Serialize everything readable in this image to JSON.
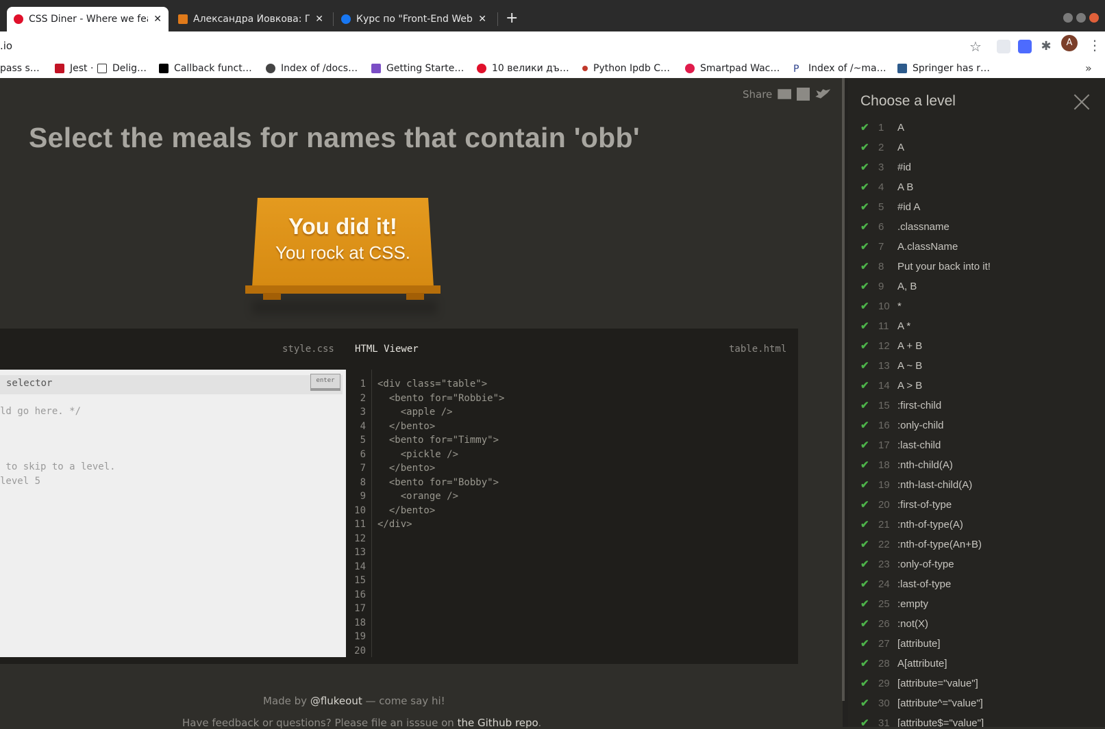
{
  "browser": {
    "tabs": [
      {
        "title": "CSS Diner - Where we feas",
        "favicon_color": "#e0102b",
        "active": true
      },
      {
        "title": "Александра Йовкова: Пу",
        "favicon_color": "#e07a1a",
        "active": false
      },
      {
        "title": "Курс по \"Front-End Web\"",
        "favicon_color": "#1877f2",
        "active": false
      }
    ],
    "new_tab_glyph": "+",
    "close_glyph": "✕",
    "address": ".io",
    "bookmarks_more": "»",
    "bookmarks": [
      {
        "label": "pass s…",
        "icon_color": "#ffffff"
      },
      {
        "label": "Jest ·",
        "icon_color": "#c21325"
      },
      {
        "label": "Delig…",
        "icon_color": "#333333"
      },
      {
        "label": "Callback funct…",
        "icon_color": "#000000"
      },
      {
        "label": "Index of /docs…",
        "icon_color": "#444444"
      },
      {
        "label": "Getting Starte…",
        "icon_color": "#7b4ec5"
      },
      {
        "label": "10 велики дъ…",
        "icon_color": "#e0102b"
      },
      {
        "label": "Python Ipdb C…",
        "icon_color": "#c0392b"
      },
      {
        "label": "Smartpad Wac…",
        "icon_color": "#e01b4b"
      },
      {
        "label": "Index of /~ma…",
        "icon_color": "#2a3f8a"
      },
      {
        "label": "Springer has r…",
        "icon_color": "#2d5b8c"
      }
    ],
    "avatar_letter": "A"
  },
  "game": {
    "share_label": "Share",
    "instruction": "Select the meals for names that contain 'obb'",
    "win_line_1": "You did it!",
    "win_line_2": "You rock at CSS.",
    "editor": {
      "css_file": "style.css",
      "html_title": "HTML Viewer",
      "html_file": "table.html",
      "selector_placeholder": "selector",
      "enter_label": "enter",
      "css_lines": [
        "ld go here. */",
        "",
        "",
        " to skip to a level.",
        "level 5"
      ],
      "html_code": [
        "<div class=\"table\">",
        "  <bento for=\"Robbie\">",
        "    <apple />",
        "  </bento>",
        "  <bento for=\"Timmy\">",
        "    <pickle />",
        "  </bento>",
        "  <bento for=\"Bobby\">",
        "    <orange />",
        "  </bento>",
        "</div>",
        "",
        "",
        "",
        "",
        "",
        "",
        "",
        "",
        ""
      ],
      "line_numbers": [
        "1",
        "2",
        "3",
        "4",
        "5",
        "6",
        "7",
        "8",
        "9",
        "10",
        "11",
        "12",
        "13",
        "14",
        "15",
        "16",
        "17",
        "18",
        "19",
        "20"
      ]
    },
    "footer": {
      "made_by_prefix": "Made by ",
      "made_by_link": "@flukeout",
      "made_by_suffix": " — come say hi!",
      "feedback_prefix": "Have feedback or questions? Please file an isssue on ",
      "feedback_link": "the Github repo",
      "feedback_suffix": "."
    }
  },
  "sidebar": {
    "title": "Choose a level",
    "check_glyph": "✔",
    "levels": [
      {
        "num": "1",
        "name": "A"
      },
      {
        "num": "2",
        "name": "A"
      },
      {
        "num": "3",
        "name": "#id"
      },
      {
        "num": "4",
        "name": "A  B"
      },
      {
        "num": "5",
        "name": "#id  A"
      },
      {
        "num": "6",
        "name": ".classname"
      },
      {
        "num": "7",
        "name": "A.className"
      },
      {
        "num": "8",
        "name": "Put your back into it!"
      },
      {
        "num": "9",
        "name": "A, B"
      },
      {
        "num": "10",
        "name": "*"
      },
      {
        "num": "11",
        "name": "A  *"
      },
      {
        "num": "12",
        "name": "A + B"
      },
      {
        "num": "13",
        "name": "A ~ B"
      },
      {
        "num": "14",
        "name": "A > B"
      },
      {
        "num": "15",
        "name": ":first-child"
      },
      {
        "num": "16",
        "name": ":only-child"
      },
      {
        "num": "17",
        "name": ":last-child"
      },
      {
        "num": "18",
        "name": ":nth-child(A)"
      },
      {
        "num": "19",
        "name": ":nth-last-child(A)"
      },
      {
        "num": "20",
        "name": ":first-of-type"
      },
      {
        "num": "21",
        "name": ":nth-of-type(A)"
      },
      {
        "num": "22",
        "name": ":nth-of-type(An+B)"
      },
      {
        "num": "23",
        "name": ":only-of-type"
      },
      {
        "num": "24",
        "name": ":last-of-type"
      },
      {
        "num": "25",
        "name": ":empty"
      },
      {
        "num": "26",
        "name": ":not(X)"
      },
      {
        "num": "27",
        "name": "[attribute]"
      },
      {
        "num": "28",
        "name": "A[attribute]"
      },
      {
        "num": "29",
        "name": "[attribute=\"value\"]"
      },
      {
        "num": "30",
        "name": "[attribute^=\"value\"]"
      },
      {
        "num": "31",
        "name": "[attribute$=\"value\"]"
      }
    ]
  }
}
